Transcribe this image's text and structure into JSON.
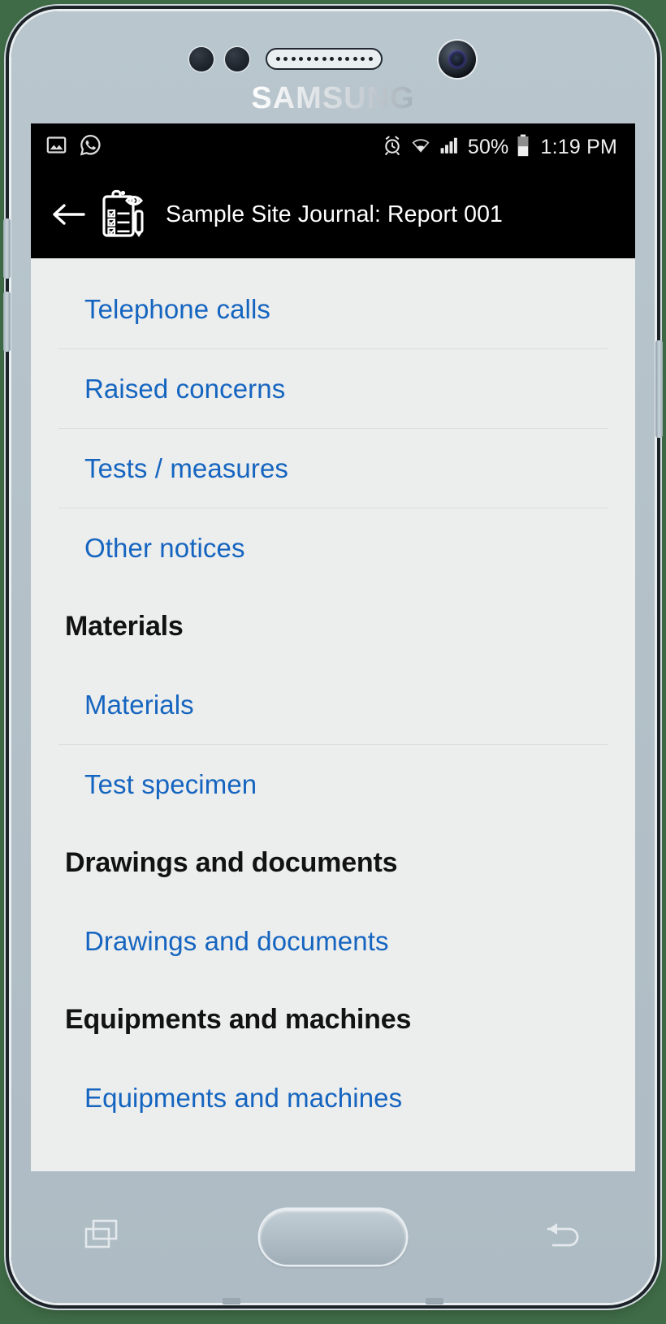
{
  "device": {
    "brand": "SAMSUNG",
    "body_color": "#b3c0c8",
    "backdrop_color": "#3f6b46"
  },
  "status_bar": {
    "background": "#000000",
    "left_icons": [
      {
        "name": "image-gallery-icon",
        "glyph": "gallery"
      },
      {
        "name": "whatsapp-icon",
        "glyph": "whatsapp"
      }
    ],
    "right_icons": [
      {
        "name": "alarm-clock-icon",
        "glyph": "alarm"
      },
      {
        "name": "wifi-icon",
        "glyph": "wifi"
      },
      {
        "name": "cellular-signal-icon",
        "glyph": "signal"
      }
    ],
    "battery_percent": "50%",
    "battery_level": 50,
    "clock": "1:19 PM"
  },
  "app_bar": {
    "back_label": "Back",
    "icon_name": "site-journal-clipboard-icon",
    "title": "Sample Site Journal: Report 001",
    "background": "#000000",
    "title_color": "#ffffff"
  },
  "list": {
    "link_color": "#1565c0",
    "header_color": "#121212",
    "background": "#eceded",
    "items": [
      {
        "type": "link",
        "label": "Telephone calls",
        "divider_after": true
      },
      {
        "type": "link",
        "label": "Raised concerns",
        "divider_after": true
      },
      {
        "type": "link",
        "label": "Tests / measures",
        "divider_after": true
      },
      {
        "type": "link",
        "label": "Other notices",
        "divider_after": false
      },
      {
        "type": "header",
        "label": "Materials",
        "divider_after": false
      },
      {
        "type": "link",
        "label": "Materials",
        "divider_after": true
      },
      {
        "type": "link",
        "label": "Test specimen",
        "divider_after": false
      },
      {
        "type": "header",
        "label": "Drawings and documents",
        "divider_after": false
      },
      {
        "type": "link",
        "label": "Drawings and documents",
        "divider_after": false
      },
      {
        "type": "header",
        "label": "Equipments and machines",
        "divider_after": false
      },
      {
        "type": "link",
        "label": "Equipments and machines",
        "divider_after": false
      }
    ]
  },
  "nav_bar": {
    "recents_label": "Recents",
    "home_label": "Home",
    "back_label": "Back"
  }
}
